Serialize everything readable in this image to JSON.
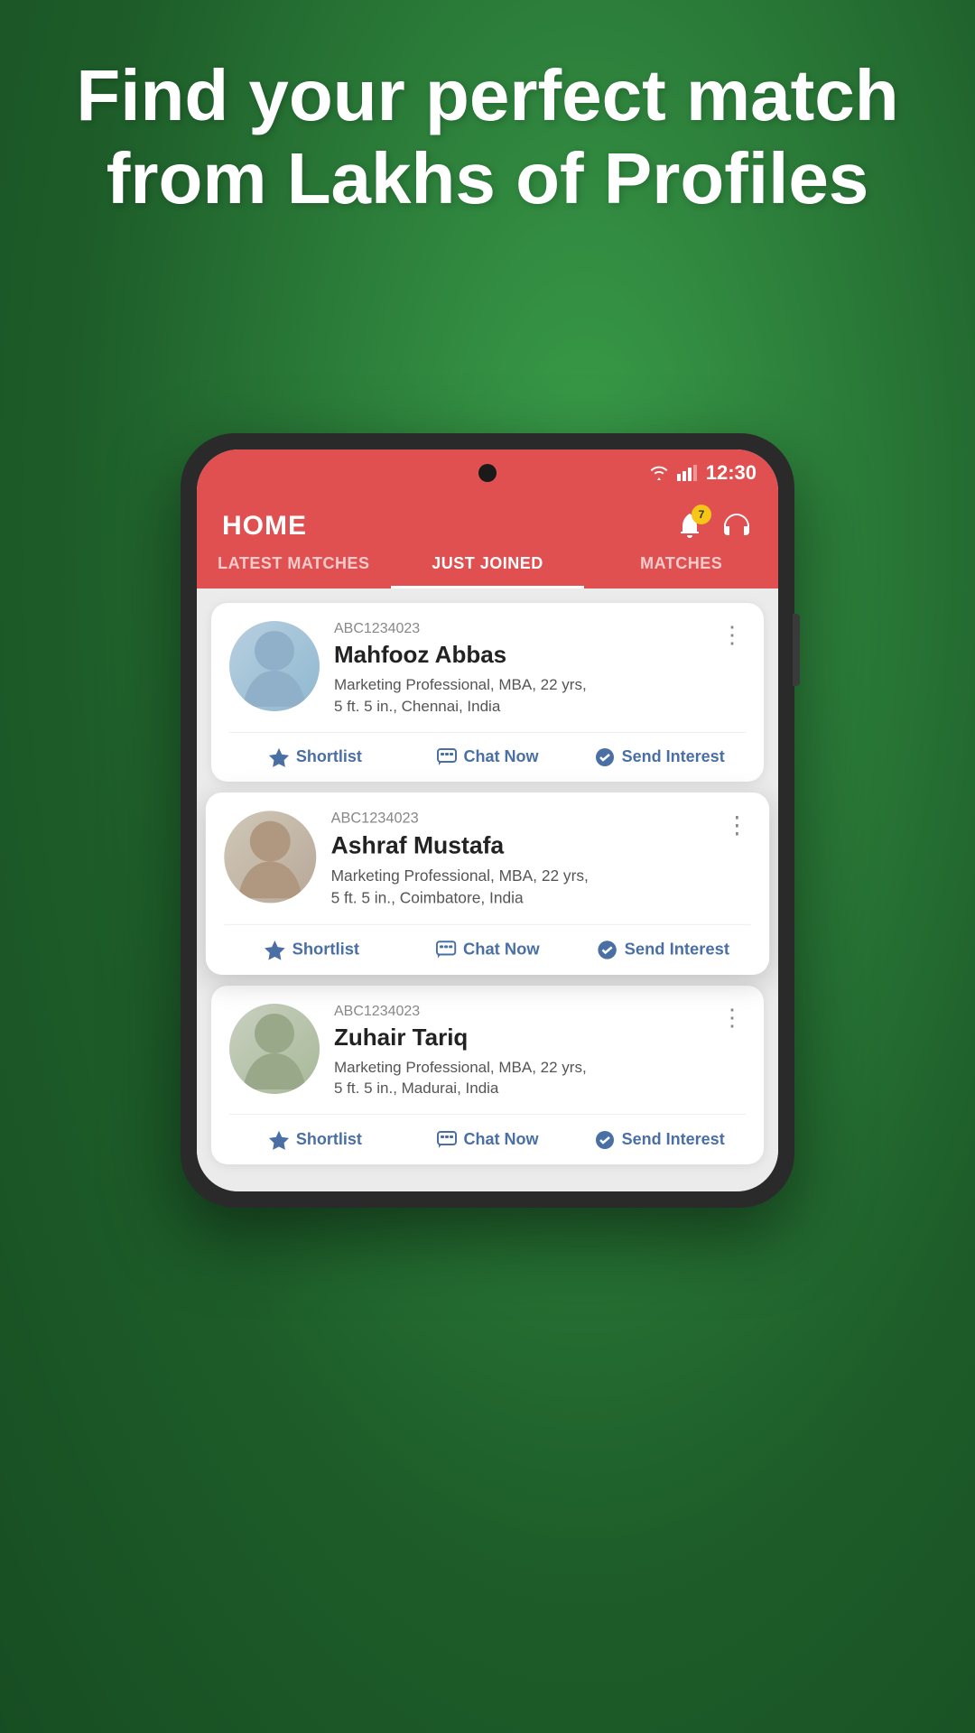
{
  "hero": {
    "title": "Find your perfect match from Lakhs of Profiles"
  },
  "app": {
    "header_title": "HOME",
    "notification_count": "7",
    "time": "12:30",
    "tabs": [
      {
        "label": "LATEST MATCHES",
        "active": false
      },
      {
        "label": "JUST JOINED",
        "active": true
      },
      {
        "label": "MATCHES",
        "active": false
      }
    ]
  },
  "profiles": [
    {
      "id": "ABC1234023",
      "name": "Mahfooz Abbas",
      "details": "Marketing Professional, MBA, 22 yrs,",
      "details2": "5 ft. 5 in., Chennai, India",
      "avatar_emoji": "👨",
      "avatar_class": "avatar-1"
    },
    {
      "id": "ABC1234023",
      "name": "Ashraf Mustafa",
      "details": "Marketing Professional, MBA, 22 yrs,",
      "details2": "5 ft. 5 in., Coimbatore, India",
      "avatar_emoji": "👨",
      "avatar_class": "avatar-2",
      "featured": true
    },
    {
      "id": "ABC1234023",
      "name": "Zuhair Tariq",
      "details": "Marketing Professional, MBA, 22 yrs,",
      "details2": "5 ft. 5 in., Madurai, India",
      "avatar_emoji": "👨",
      "avatar_class": "avatar-3"
    }
  ],
  "actions": {
    "shortlist": "Shortlist",
    "chat": "Chat Now",
    "interest": "Send Interest"
  },
  "colors": {
    "bg_green": "#2d7a3a",
    "header_red": "#e05050",
    "action_blue": "#4a6fa5"
  }
}
